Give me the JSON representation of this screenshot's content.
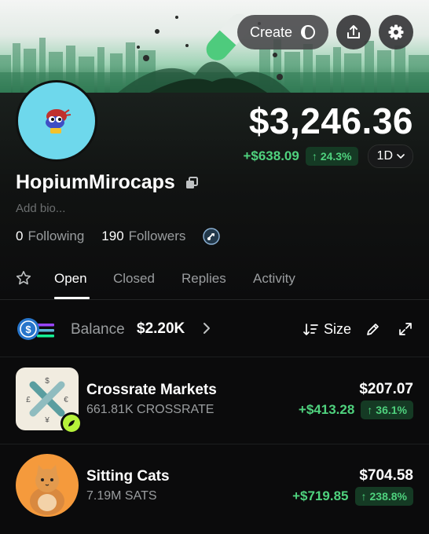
{
  "header": {
    "create_label": "Create",
    "icons": [
      "create-circle-icon",
      "share-icon",
      "settings-gear-icon"
    ]
  },
  "profile": {
    "portfolio_value": "$3,246.36",
    "change_abs": "+$638.09",
    "change_pct": "24.3%",
    "period": "1D",
    "username": "HopiumMirocaps",
    "bio_placeholder": "Add bio...",
    "following_count": "0",
    "following_label": "Following",
    "followers_count": "190",
    "followers_label": "Followers"
  },
  "tabs": [
    {
      "label": "Open",
      "active": true
    },
    {
      "label": "Closed",
      "active": false
    },
    {
      "label": "Replies",
      "active": false
    },
    {
      "label": "Activity",
      "active": false
    }
  ],
  "balance": {
    "label": "Balance",
    "value": "$2.20K",
    "sort_label": "Size"
  },
  "holdings": [
    {
      "name": "Crossrate Markets",
      "amount": "661.81K CROSSRATE",
      "value": "$207.07",
      "change_abs": "+$413.28",
      "change_pct": "36.1%"
    },
    {
      "name": "Sitting Cats",
      "amount": "7.19M SATS",
      "value": "$704.58",
      "change_abs": "+$719.85",
      "change_pct": "238.8%"
    }
  ],
  "colors": {
    "positive": "#4fd27e",
    "positive_bg": "#153a24",
    "background": "#0b0b0c",
    "avatar_bg": "#6ed8ec"
  }
}
